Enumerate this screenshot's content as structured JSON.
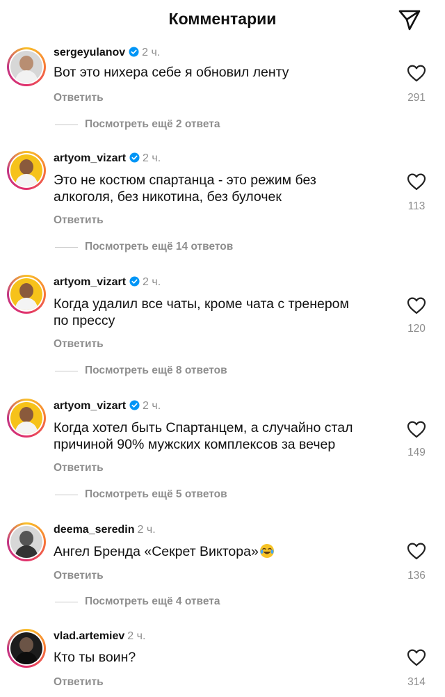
{
  "header": {
    "title": "Комментарии",
    "icon": "send-icon"
  },
  "colors": {
    "verified": "#0095f6",
    "secondary_text": "#8e8e8e",
    "ring": "#e1306c"
  },
  "comments": [
    {
      "username": "sergeyulanov",
      "verified": true,
      "time": "2 ч.",
      "lines": [
        "Вот это нихера себе я обновил ленту"
      ],
      "reply": "Ответить",
      "likes": "291",
      "more": "Посмотреть ещё 2 ответа"
    },
    {
      "username": "artyom_vizart",
      "verified": true,
      "time": "2 ч.",
      "lines": [
        "Это не костюм спартанца - это режим без",
        "алкоголя, без никотина, без булочек"
      ],
      "reply": "Ответить",
      "likes": "113",
      "more": "Посмотреть ещё 14 ответов"
    },
    {
      "username": "artyom_vizart",
      "verified": true,
      "time": "2 ч.",
      "lines": [
        "Когда удалил все чаты, кроме чата с тренером",
        "по прессу"
      ],
      "reply": "Ответить",
      "likes": "120",
      "more": "Посмотреть ещё 8 ответов"
    },
    {
      "username": "artyom_vizart",
      "verified": true,
      "time": "2 ч.",
      "lines": [
        "Когда хотел быть Спартанцем, а случайно стал",
        "причиной 90% мужских комплексов за вечер"
      ],
      "reply": "Ответить",
      "likes": "149",
      "more": "Посмотреть ещё 5 ответов"
    },
    {
      "username": "deema_seredin",
      "verified": false,
      "time": "2 ч.",
      "lines": [
        "Ангел Бренда «Секрет Виктора»"
      ],
      "emoji": "tears-of-joy-emoji",
      "reply": "Ответить",
      "likes": "136",
      "more": "Посмотреть ещё 4 ответа"
    },
    {
      "username": "vlad.artemiev",
      "verified": false,
      "time": "2 ч.",
      "lines": [
        "Кто ты воин?"
      ],
      "reply": "Ответить",
      "likes": "314"
    }
  ]
}
